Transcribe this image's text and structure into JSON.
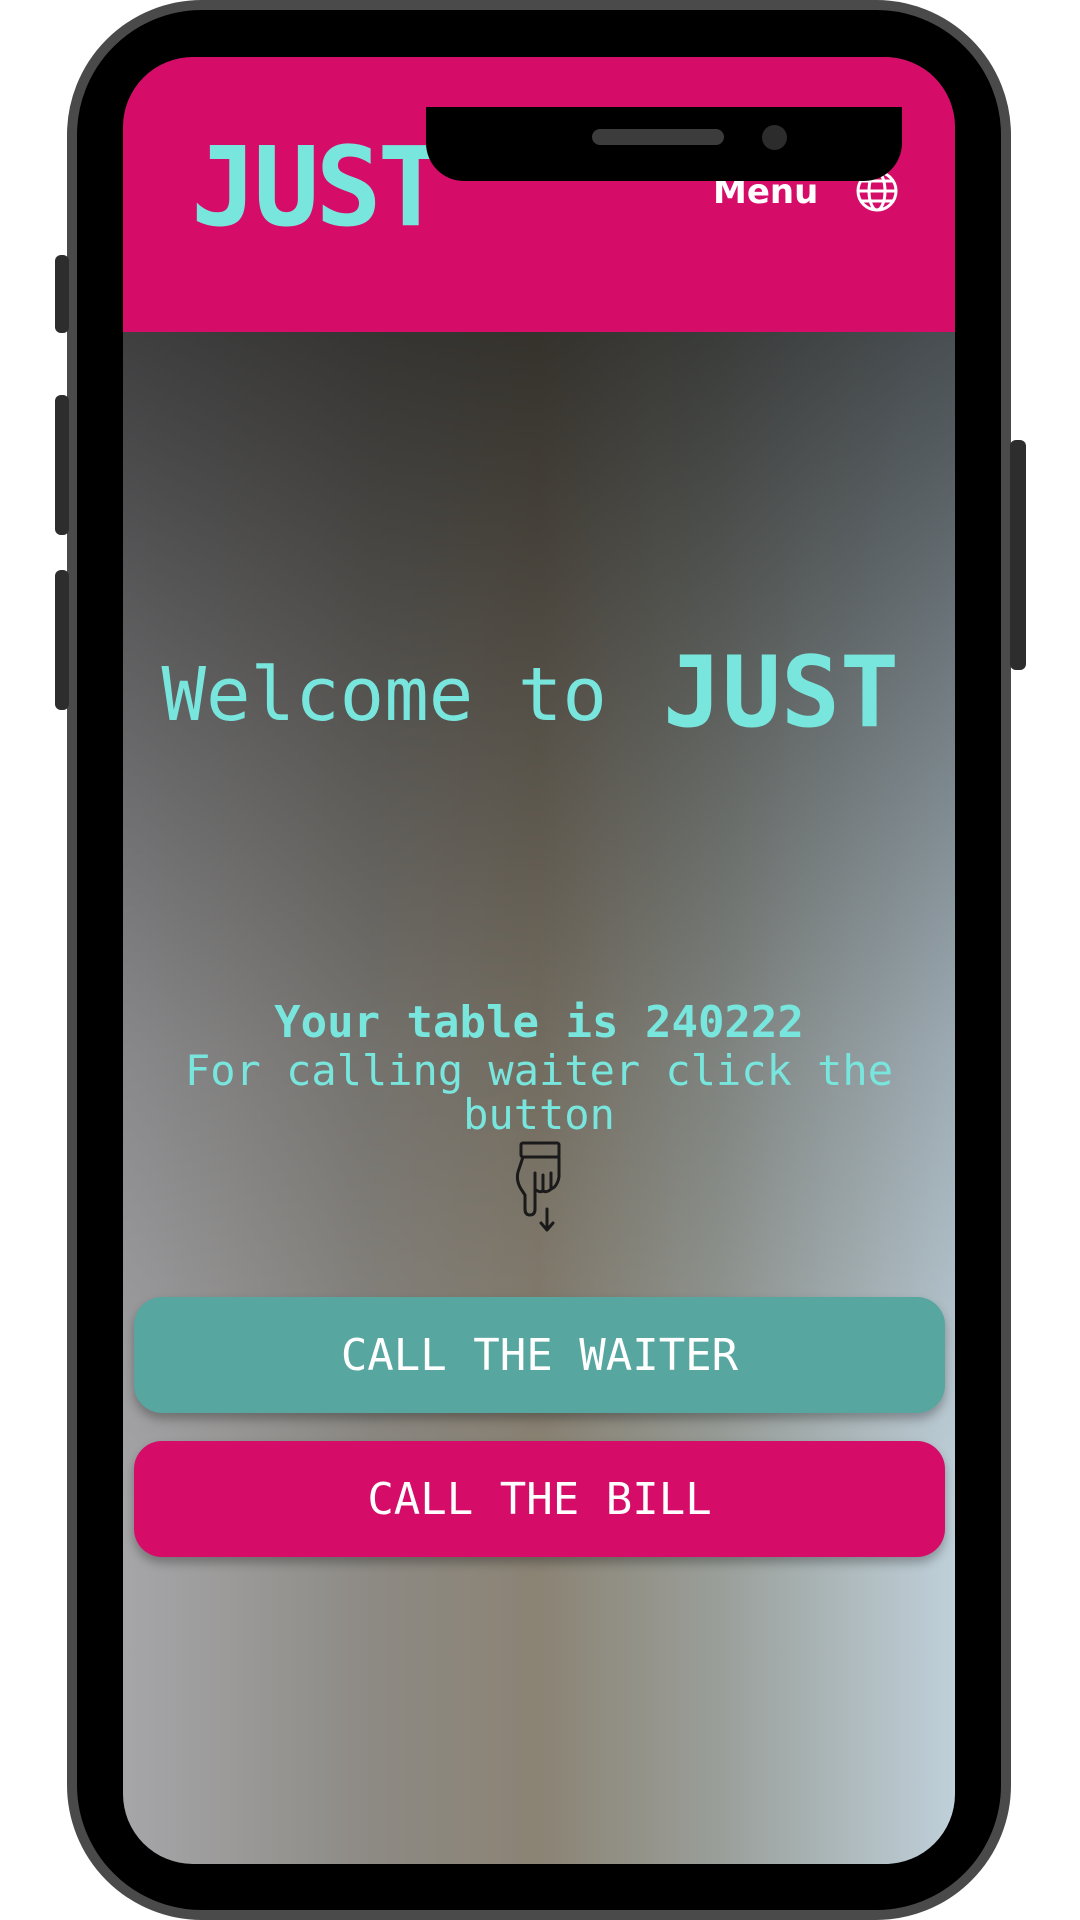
{
  "header": {
    "brand": "JUST",
    "menu_label": "Menu",
    "language_icon": "globe-icon"
  },
  "hero": {
    "welcome_text": "Welcome to",
    "welcome_brand": "JUST"
  },
  "table_info": {
    "table_text": "Your table is 240222",
    "instruction": "For calling waiter click the button",
    "pointer_icon": "hand-pointing-down-icon"
  },
  "actions": {
    "call_waiter_label": "CALL THE WAITER",
    "call_bill_label": "CALL THE BILL"
  },
  "colors": {
    "brand_pink": "#d50d69",
    "accent_teal": "#79e6de",
    "waiter_button": "#57a6a0"
  }
}
